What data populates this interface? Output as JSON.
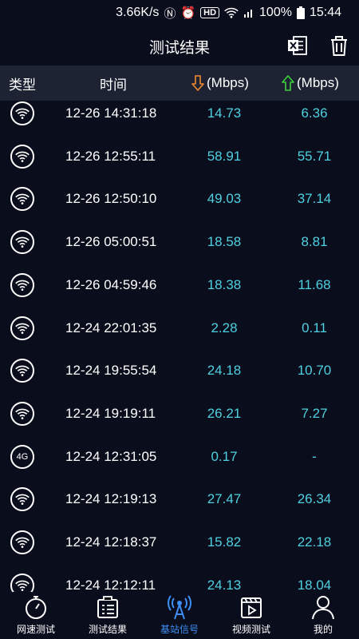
{
  "status_bar": {
    "speed": "3.66K/s",
    "hd": "HD",
    "battery": "100%",
    "time": "15:44"
  },
  "title": "测试结果",
  "header": {
    "type": "类型",
    "time": "时间",
    "down_unit": "(Mbps)",
    "up_unit": "(Mbps)"
  },
  "rows": [
    {
      "type": "wifi",
      "time": "12-26 14:31:18",
      "down": "14.73",
      "up": "6.36"
    },
    {
      "type": "wifi",
      "time": "12-26 12:55:11",
      "down": "58.91",
      "up": "55.71"
    },
    {
      "type": "wifi",
      "time": "12-26 12:50:10",
      "down": "49.03",
      "up": "37.14"
    },
    {
      "type": "wifi",
      "time": "12-26 05:00:51",
      "down": "18.58",
      "up": "8.81"
    },
    {
      "type": "wifi",
      "time": "12-26 04:59:46",
      "down": "18.38",
      "up": "11.68"
    },
    {
      "type": "wifi",
      "time": "12-24 22:01:35",
      "down": "2.28",
      "up": "0.11"
    },
    {
      "type": "wifi",
      "time": "12-24 19:55:54",
      "down": "24.18",
      "up": "10.70"
    },
    {
      "type": "wifi",
      "time": "12-24 19:19:11",
      "down": "26.21",
      "up": "7.27"
    },
    {
      "type": "4g",
      "label": "4G",
      "time": "12-24 12:31:05",
      "down": "0.17",
      "up": "-"
    },
    {
      "type": "wifi",
      "time": "12-24 12:19:13",
      "down": "27.47",
      "up": "26.34"
    },
    {
      "type": "wifi",
      "time": "12-24 12:18:37",
      "down": "15.82",
      "up": "22.18"
    },
    {
      "type": "wifi",
      "time": "12-24 12:12:11",
      "down": "24.13",
      "up": "18.04"
    }
  ],
  "nav": [
    {
      "label": "网速测试",
      "icon": "stopwatch-icon"
    },
    {
      "label": "测试结果",
      "icon": "results-list-icon"
    },
    {
      "label": "基站信号",
      "icon": "tower-signal-icon",
      "active": true
    },
    {
      "label": "视频测试",
      "icon": "video-icon"
    },
    {
      "label": "我的",
      "icon": "person-icon"
    }
  ],
  "colors": {
    "background": "#0a0d1c",
    "header": "#1d2333",
    "value": "#4fd0e0",
    "down_arrow": "#f08a30",
    "up_arrow": "#3dd13d",
    "active": "#3d8ff5"
  }
}
